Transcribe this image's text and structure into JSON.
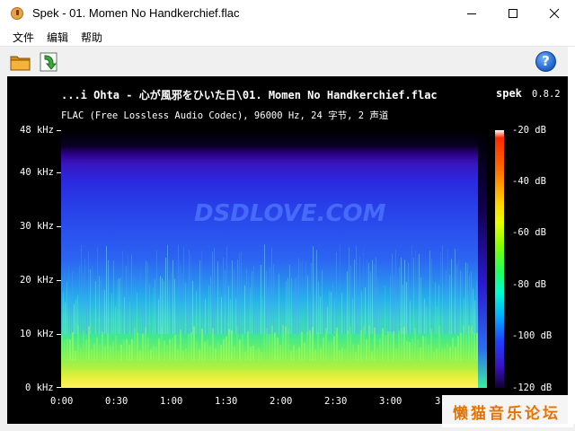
{
  "window": {
    "title": "Spek - 01. Momen No Handkerchief.flac",
    "controls": {
      "minimize": "minimize-icon",
      "maximize": "maximize-icon",
      "close": "close-icon"
    }
  },
  "menu": {
    "items": [
      "文件",
      "编辑",
      "帮助"
    ]
  },
  "toolbar": {
    "open_icon": "folder-icon",
    "save_icon": "save-icon",
    "help_label": "?"
  },
  "plot": {
    "title": "...i Ohta - 心が風邪をひいた日\\01. Momen No Handkerchief.flac",
    "app_label": "spek",
    "version": "0.8.2",
    "subtitle": "FLAC (Free Lossless Audio Codec), 96000 Hz, 24 字节, 2 声道",
    "watermark": "DSDLOVE.COM",
    "freq_ticks": [
      "48 kHz",
      "40 kHz",
      "30 kHz",
      "20 kHz",
      "10 kHz",
      "0 kHz"
    ],
    "time_ticks": [
      "0:00",
      "0:30",
      "1:00",
      "1:30",
      "2:00",
      "2:30",
      "3:00",
      "3:"
    ],
    "db_ticks": [
      "-20 dB",
      "-40 dB",
      "-60 dB",
      "-80 dB",
      "-100 dB",
      "-120 dB"
    ]
  },
  "brand": {
    "text": "懒猫音乐论坛",
    "color": "#f07800"
  }
}
